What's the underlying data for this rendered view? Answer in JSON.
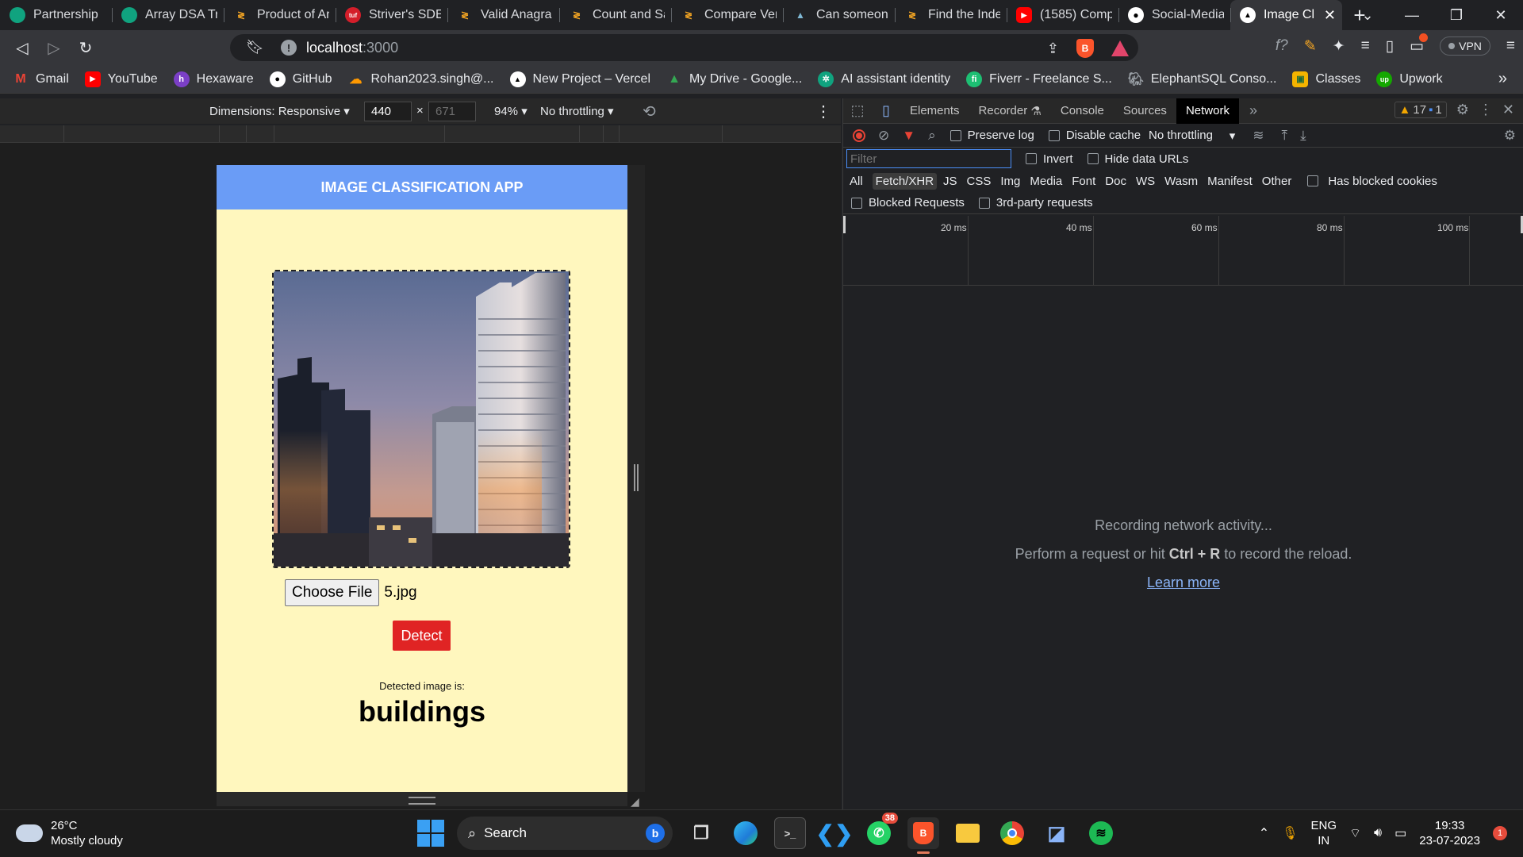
{
  "tabs": [
    {
      "title": "Partnership",
      "icon": "chatgpt-icon",
      "color": "#10a37f"
    },
    {
      "title": "Array DSA Tr",
      "icon": "chatgpt-icon",
      "color": "#10a37f"
    },
    {
      "title": "Product of Ar",
      "icon": "codestudio-icon",
      "color": "#f5a623"
    },
    {
      "title": "Striver's SDE",
      "icon": "tuf-icon",
      "color": "#d41e2a"
    },
    {
      "title": "Valid Anagra",
      "icon": "codestudio-icon",
      "color": "#f5a623"
    },
    {
      "title": "Count and Sa",
      "icon": "codestudio-icon",
      "color": "#f5a623"
    },
    {
      "title": "Compare Ver",
      "icon": "codestudio-icon",
      "color": "#f5a623"
    },
    {
      "title": "Can someone",
      "icon": "mountain-icon",
      "color": "#7fb8d4"
    },
    {
      "title": "Find the Inde",
      "icon": "codestudio-icon",
      "color": "#f5a623"
    },
    {
      "title": "(1585) Comp",
      "icon": "youtube-icon",
      "color": "#ff0000"
    },
    {
      "title": "Social-Media",
      "icon": "github-icon",
      "color": "#ffffff"
    },
    {
      "title": "Image Cl",
      "icon": "vercel-icon",
      "color": "#ffffff",
      "active": true
    }
  ],
  "omnibox": {
    "host": "localhost",
    "port": ":3000"
  },
  "bookmarks": [
    {
      "label": "Gmail",
      "icon": "gmail-icon",
      "color": "#ea4335"
    },
    {
      "label": "YouTube",
      "icon": "youtube-icon",
      "color": "#ff0000"
    },
    {
      "label": "Hexaware",
      "icon": "hexaware-icon",
      "color": "#7b3fc6"
    },
    {
      "label": "GitHub",
      "icon": "github-icon",
      "color": "#ffffff"
    },
    {
      "label": "Rohan2023.singh@...",
      "icon": "aws-icon",
      "color": "#ff9900"
    },
    {
      "label": "New Project – Vercel",
      "icon": "vercel-icon",
      "color": "#ffffff"
    },
    {
      "label": "My Drive - Google...",
      "icon": "drive-icon",
      "color": "#34a853"
    },
    {
      "label": "AI assistant identity",
      "icon": "chatgpt-icon",
      "color": "#10a37f"
    },
    {
      "label": "Fiverr - Freelance S...",
      "icon": "fiverr-icon",
      "color": "#1dbf73"
    },
    {
      "label": "ElephantSQL Conso...",
      "icon": "elephant-icon",
      "color": "#9aa0a6"
    },
    {
      "label": "Classes",
      "icon": "classroom-icon",
      "color": "#f4b400"
    },
    {
      "label": "Upwork",
      "icon": "upwork-icon",
      "color": "#14a800"
    }
  ],
  "device_toolbar": {
    "dimensions": "Dimensions: Responsive",
    "width": "440",
    "height": "671",
    "zoom": "94%",
    "throttling": "No throttling"
  },
  "app": {
    "header": "IMAGE CLASSIFICATION APP",
    "choose_file": "Choose File",
    "file_name": "5.jpg",
    "detect": "Detect",
    "detected_label": "Detected image is:",
    "result": "buildings"
  },
  "devtools": {
    "tabs": [
      "Elements",
      "Recorder",
      "Console",
      "Sources",
      "Network"
    ],
    "active_tab": "Network",
    "warnings": "17",
    "messages": "1",
    "preserve_log": "Preserve log",
    "disable_cache": "Disable cache",
    "throttling": "No throttling",
    "filter_placeholder": "Filter",
    "invert": "Invert",
    "hide_data_urls": "Hide data URLs",
    "types": [
      "All",
      "Fetch/XHR",
      "JS",
      "CSS",
      "Img",
      "Media",
      "Font",
      "Doc",
      "WS",
      "Wasm",
      "Manifest",
      "Other"
    ],
    "active_type": "Fetch/XHR",
    "has_blocked_cookies": "Has blocked cookies",
    "blocked_requests": "Blocked Requests",
    "third_party": "3rd-party requests",
    "timeline_ticks": [
      "20 ms",
      "40 ms",
      "60 ms",
      "80 ms",
      "100 ms"
    ],
    "empty_title": "Recording network activity...",
    "empty_hint_pre": "Perform a request or hit ",
    "empty_hint_key": "Ctrl + R",
    "empty_hint_post": " to record the reload.",
    "learn_more": "Learn more"
  },
  "taskbar": {
    "temperature": "26°C",
    "weather": "Mostly cloudy",
    "search": "Search",
    "whatsapp_badge": "38",
    "lang": "ENG",
    "region": "IN",
    "time": "19:33",
    "date": "23-07-2023",
    "notifications": "1"
  }
}
